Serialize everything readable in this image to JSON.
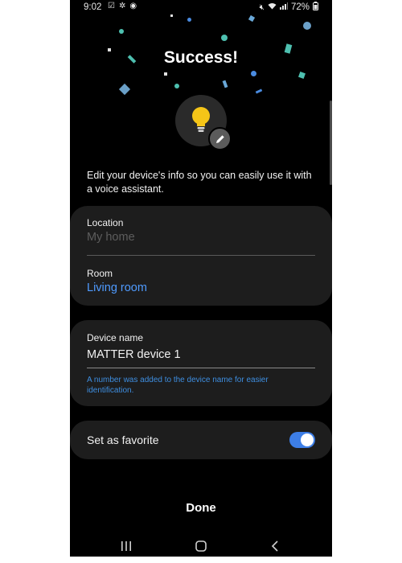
{
  "status_bar": {
    "time": "9:02",
    "battery": "72%"
  },
  "header": {
    "title": "Success!"
  },
  "device": {
    "icon": "lightbulb-icon",
    "bulb_color": "#f5c518",
    "edit_icon": "pencil-icon"
  },
  "intro_text": "Edit your device's info so you can easily use it with a voice assistant.",
  "location": {
    "label": "Location",
    "placeholder": "My home"
  },
  "room": {
    "label": "Room",
    "value": "Living room"
  },
  "device_name": {
    "label": "Device name",
    "value": "MATTER device 1",
    "note": "A number was added to the device name for easier identification."
  },
  "favorite": {
    "label": "Set as favorite",
    "enabled": true
  },
  "done_label": "Done",
  "colors": {
    "accent": "#3d7ee6",
    "link": "#4f9bff",
    "card": "#1d1d1d",
    "background": "#000000"
  }
}
